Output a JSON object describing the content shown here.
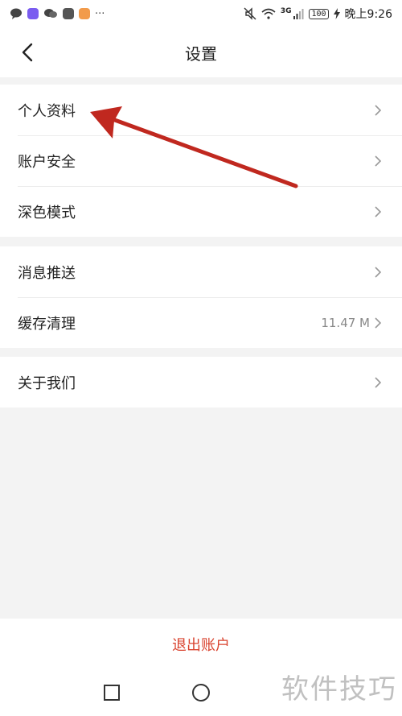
{
  "status_bar": {
    "network": "3G",
    "battery": "100",
    "time": "晚上9:26",
    "more": "···"
  },
  "header": {
    "title": "设置"
  },
  "groups": [
    {
      "items": [
        {
          "label": "个人资料"
        },
        {
          "label": "账户安全"
        },
        {
          "label": "深色模式"
        }
      ]
    },
    {
      "items": [
        {
          "label": "消息推送"
        },
        {
          "label": "缓存清理",
          "value": "11.47 M"
        }
      ]
    },
    {
      "items": [
        {
          "label": "关于我们"
        }
      ]
    }
  ],
  "logout": {
    "label": "退出账户"
  },
  "watermark": "软件技巧",
  "colors": {
    "accent": "#d9432f",
    "annotation_arrow": "#c0281f",
    "background": "#f3f3f3"
  }
}
